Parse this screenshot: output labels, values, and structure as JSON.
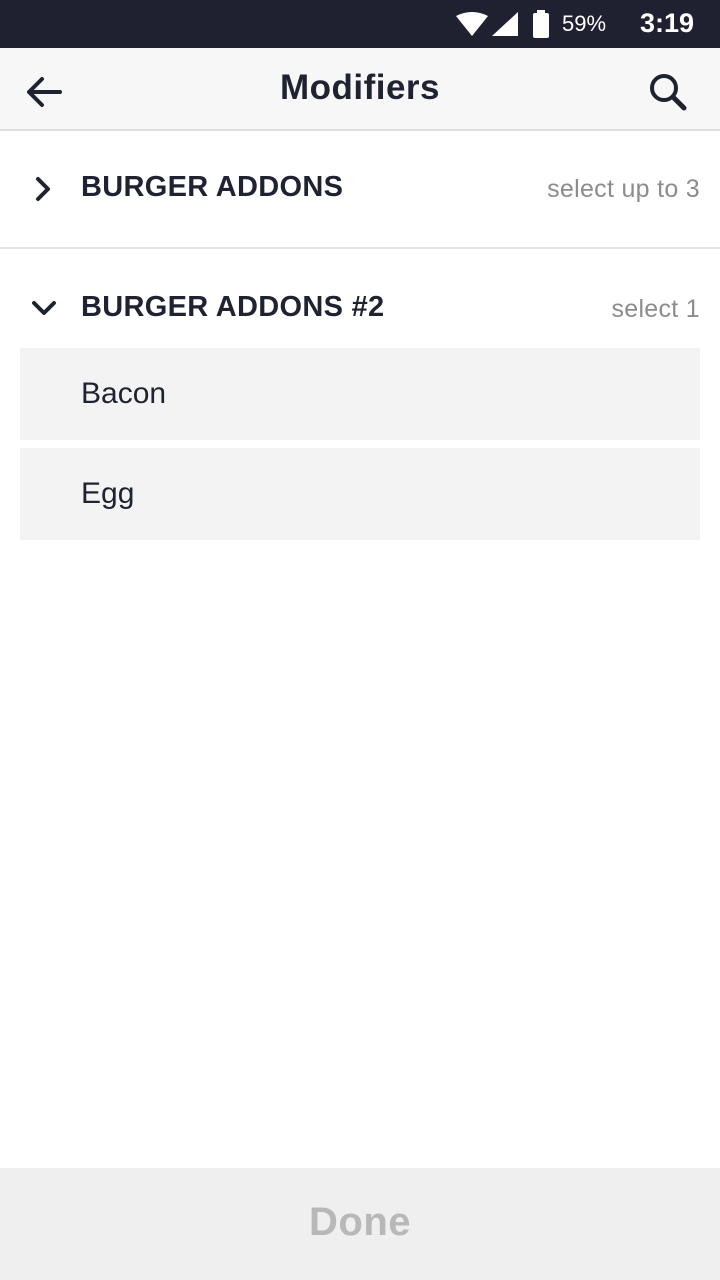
{
  "status_bar": {
    "battery_percent": "59%",
    "time": "3:19",
    "icons": [
      "wifi-icon",
      "signal-icon",
      "battery-icon"
    ]
  },
  "app_bar": {
    "title": "Modifiers",
    "back_icon": "arrow-left-icon",
    "search_icon": "search-icon"
  },
  "groups": [
    {
      "name": "BURGER ADDONS",
      "rule": "select up to 3",
      "expanded": false,
      "icon": "chevron-right-icon"
    },
    {
      "name": "BURGER ADDONS #2",
      "rule": "select 1",
      "expanded": true,
      "icon": "chevron-down-icon",
      "options": [
        {
          "label": "Bacon"
        },
        {
          "label": "Egg"
        }
      ]
    }
  ],
  "footer": {
    "done_label": "Done"
  },
  "colors": {
    "status_bar": "#1f2130",
    "text_primary": "#1f2230",
    "text_secondary": "#8c8c8c",
    "option_bg": "#f3f3f3",
    "done_disabled": "#b8b8b8"
  }
}
